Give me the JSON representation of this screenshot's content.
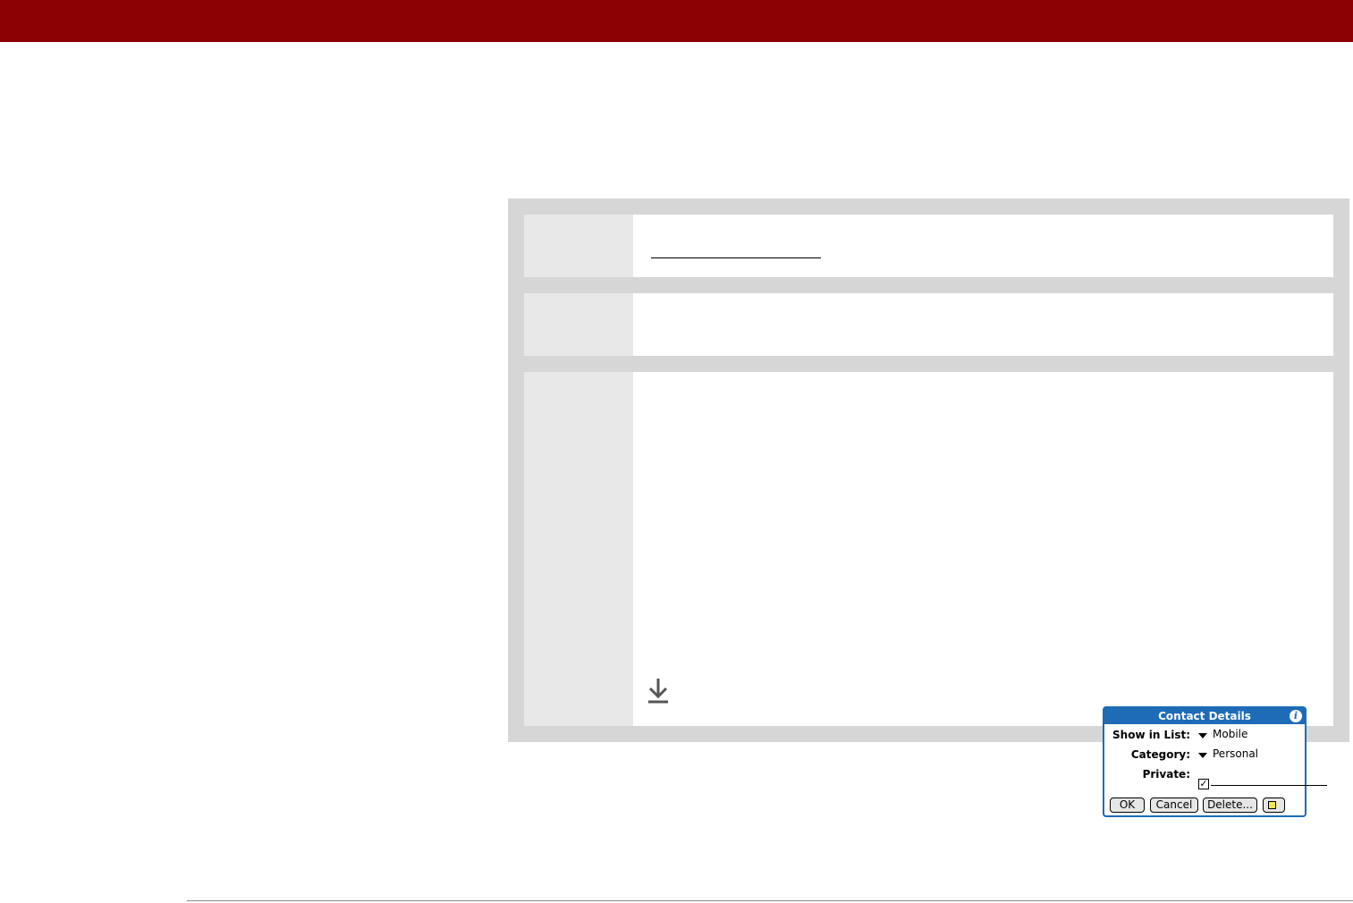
{
  "dialog": {
    "title": "Contact Details",
    "show_in_list_label": "Show in List:",
    "show_in_list_value": "Mobile",
    "category_label": "Category:",
    "category_value": "Personal",
    "private_label": "Private:",
    "private_checked": true,
    "private_check_glyph": "✓",
    "buttons": {
      "ok": "OK",
      "cancel": "Cancel",
      "delete": "Delete..."
    }
  },
  "colors": {
    "header_bar": "#8b0000",
    "dialog_accent": "#1e6bb8",
    "note_icon": "#f2e94a"
  },
  "icons": {
    "info": "info-icon",
    "dropdown": "triangle-down-icon",
    "note": "note-icon",
    "download": "download-arrow-icon"
  }
}
